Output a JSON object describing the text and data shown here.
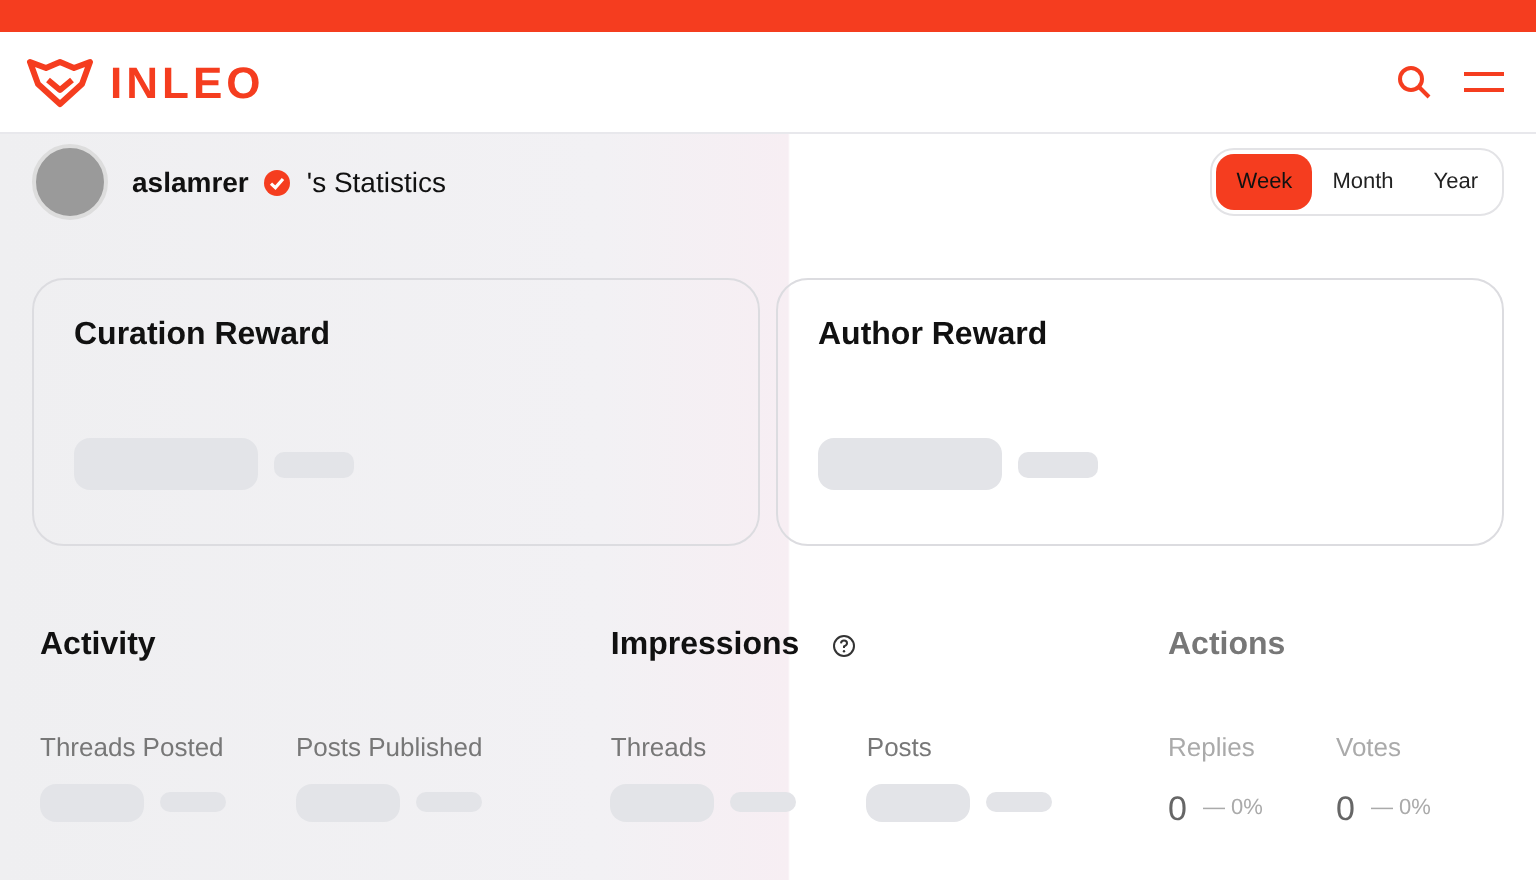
{
  "header": {
    "logo_text": "INLEO"
  },
  "profile": {
    "username": "aslamrer",
    "verified": true,
    "title_suffix": "'s Statistics"
  },
  "periods": [
    {
      "label": "Week",
      "selected": true
    },
    {
      "label": "Month",
      "selected": false
    },
    {
      "label": "Year",
      "selected": false
    }
  ],
  "reward_cards": [
    {
      "title": "Curation Reward"
    },
    {
      "title": "Author Reward"
    }
  ],
  "sections": [
    {
      "title": "Activity",
      "kind": "loading",
      "muted": false,
      "help": false,
      "metrics": [
        {
          "label": "Threads Posted"
        },
        {
          "label": "Posts Published"
        }
      ]
    },
    {
      "title": "Impressions",
      "kind": "loading",
      "muted": false,
      "help": true,
      "metrics": [
        {
          "label": "Threads"
        },
        {
          "label": "Posts"
        }
      ]
    },
    {
      "title": "Actions",
      "kind": "values",
      "muted": true,
      "help": false,
      "metrics": [
        {
          "label": "Replies",
          "value": "0",
          "change": "— 0%"
        },
        {
          "label": "Votes",
          "value": "0",
          "change": "— 0%"
        }
      ]
    }
  ]
}
